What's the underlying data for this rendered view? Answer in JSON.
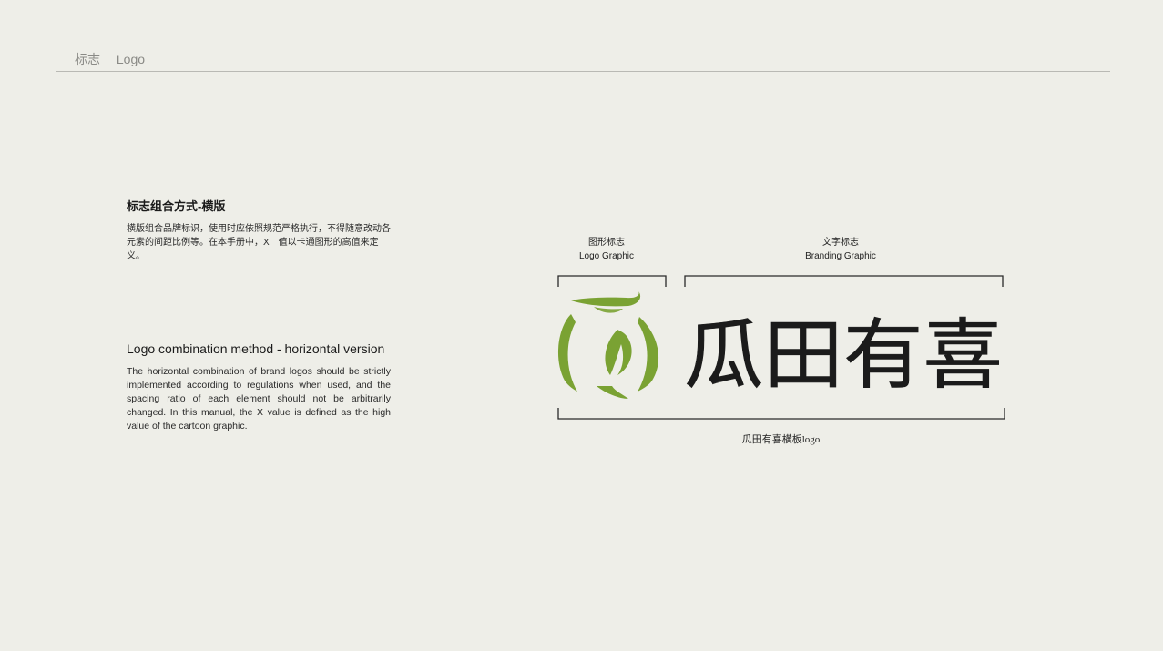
{
  "header": {
    "section_cn": "标志",
    "section_en": "Logo"
  },
  "intro": {
    "title_cn": "标志组合方式-横版",
    "desc_cn": "横版组合品牌标识，使用时应依照规范严格执行，不得随意改动各元素的间距比例等。在本手册中，X　值以卡通图形的高值来定义。",
    "title_en": "Logo combination method - horizontal version",
    "desc_en": "The horizontal combination of brand logos should be strictly implemented according to regulations when used, and the spacing ratio of each element should not be arbitrarily changed. In this manual, the X value is defined as the high value of the cartoon graphic."
  },
  "diagram": {
    "graphic_label_cn": "图形标志",
    "graphic_label_en": "Logo Graphic",
    "branding_label_cn": "文字标志",
    "branding_label_en": "Branding Graphic",
    "wordmark": "瓜田有喜",
    "caption": "瓜田有喜横板logo",
    "brand_green": "#7aa233",
    "ink": "#1b1b1b"
  }
}
